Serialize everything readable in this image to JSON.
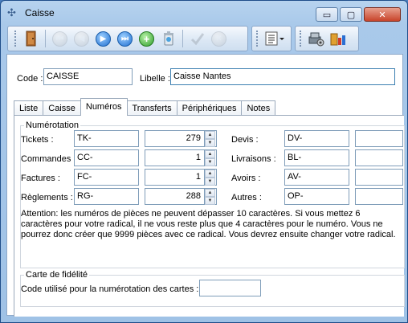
{
  "window": {
    "title": "Caisse"
  },
  "titlebar": {
    "minimize": "▭",
    "maximize": "▢",
    "close": "✕"
  },
  "toolbar": {
    "icons": [
      "door-exit-icon",
      "first-record-icon",
      "previous-record-icon",
      "next-record-icon",
      "last-record-icon",
      "add-record-icon",
      "delete-record-icon",
      "validate-icon",
      "cancel-icon",
      "report-dropdown-icon",
      "settings-icon",
      "statistics-icon"
    ]
  },
  "header": {
    "code_label": "Code :",
    "code_value": "CAISSE",
    "libelle_label": "Libelle :",
    "libelle_value": "Caisse Nantes"
  },
  "tabs": [
    {
      "label": "Liste"
    },
    {
      "label": "Caisse"
    },
    {
      "label": "Numéros",
      "active": true
    },
    {
      "label": "Transferts"
    },
    {
      "label": "Périphériques"
    },
    {
      "label": "Notes"
    }
  ],
  "numerotation": {
    "group_title": "Numérotation",
    "left_rows": [
      {
        "label": "Tickets :",
        "prefix": "TK-",
        "number": "279"
      },
      {
        "label": "Commandes :",
        "prefix": "CC-",
        "number": "1"
      },
      {
        "label": "Factures :",
        "prefix": "FC-",
        "number": "1"
      },
      {
        "label": "Règlements :",
        "prefix": "RG-",
        "number": "288"
      }
    ],
    "right_rows": [
      {
        "label": "Devis :",
        "prefix": "DV-"
      },
      {
        "label": "Livraisons :",
        "prefix": "BL-"
      },
      {
        "label": "Avoirs :",
        "prefix": "AV-"
      },
      {
        "label": "Autres :",
        "prefix": "OP-"
      }
    ],
    "attention": "Attention: les numéros de pièces ne peuvent dépasser 10 caractères. Si vous mettez 6 caractères pour votre radical, il ne vous reste plus que 4 caractères pour le numéro. Vous ne pourrez donc créer que 9999 pièces avec ce radical. Vous devrez ensuite changer votre radical."
  },
  "fidelite": {
    "group_title": "Carte de fidélité",
    "code_label": "Code utilisé pour la numérotation des cartes :",
    "code_value": ""
  },
  "spinner": {
    "up": "▲",
    "down": "▼"
  }
}
